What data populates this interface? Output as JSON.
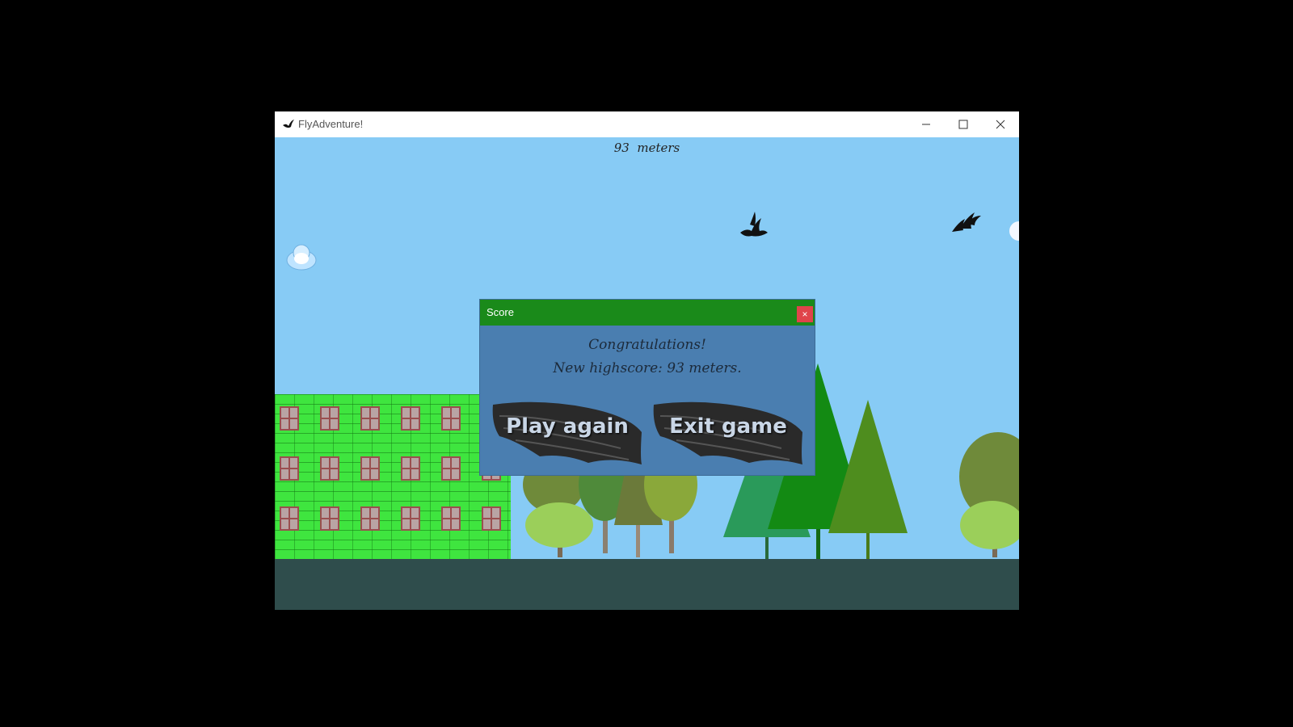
{
  "window": {
    "title": "FlyAdventure!",
    "icon": "bird-icon",
    "controls": [
      "minimize-icon",
      "maximize-icon",
      "close-icon"
    ]
  },
  "hud": {
    "distance_value": "93",
    "distance_unit": "meters"
  },
  "dialog": {
    "title": "Score",
    "close_label": "×",
    "line1": "Congratulations!",
    "line2": "New highscore: 93 meters.",
    "play_again_label": "Play again",
    "exit_label": "Exit game"
  },
  "colors": {
    "sky": "#87cbf5",
    "dialog_bar": "#1a8a1a",
    "dialog_body": "#4a7eb0",
    "close_button": "#e0444a",
    "building": "#3fe53f",
    "ground": "#2f4d4c"
  }
}
